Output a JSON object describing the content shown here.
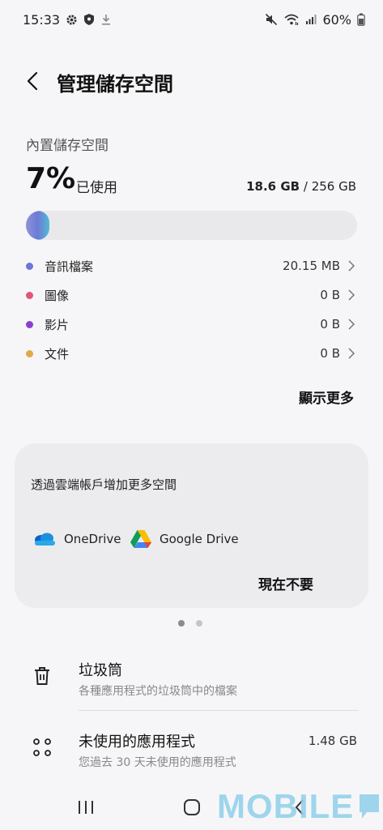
{
  "status_bar": {
    "time": "15:33",
    "battery": "60%",
    "icons_left": [
      "gear-icon",
      "shield-icon",
      "download-icon"
    ],
    "icons_right": [
      "mute-icon",
      "wifi-icon",
      "signal-icon",
      "battery-icon"
    ]
  },
  "header": {
    "title": "管理儲存空間",
    "back_icon": "back-arrow-icon"
  },
  "storage": {
    "section_label": "內置儲存空間",
    "percent": "7%",
    "used_label": "已使用",
    "used_amount": "18.6 GB",
    "total_amount": "256 GB",
    "usage_fraction": 0.07,
    "bar_colors": [
      "#8e93d8",
      "#6d7bd6",
      "#53b9d6"
    ],
    "categories": [
      {
        "label": "音訊檔案",
        "value": "20.15 MB",
        "color": "#6f74d9"
      },
      {
        "label": "圖像",
        "value": "0 B",
        "color": "#e2557a"
      },
      {
        "label": "影片",
        "value": "0 B",
        "color": "#8b3fd1"
      },
      {
        "label": "文件",
        "value": "0 B",
        "color": "#e0a94a"
      }
    ],
    "show_more": "顯示更多"
  },
  "cloud": {
    "title": "透過雲端帳戶增加更多空間",
    "options": [
      {
        "label": "OneDrive",
        "icon": "onedrive-icon"
      },
      {
        "label": "Google Drive",
        "icon": "google-drive-icon"
      }
    ],
    "not_now": "現在不要"
  },
  "list": [
    {
      "title": "垃圾筒",
      "subtitle": "各種應用程式的垃圾筒中的檔案",
      "value": "",
      "icon": "trash-icon"
    },
    {
      "title": "未使用的應用程式",
      "subtitle": "您過去 30 天未使用的應用程式",
      "value": "1.48 GB",
      "icon": "apps-grid-icon"
    }
  ],
  "nav": {
    "recents_icon": "recents-icon",
    "home_icon": "home-icon",
    "back_icon": "nav-back-icon"
  },
  "watermark": {
    "text": "MOBILE"
  }
}
